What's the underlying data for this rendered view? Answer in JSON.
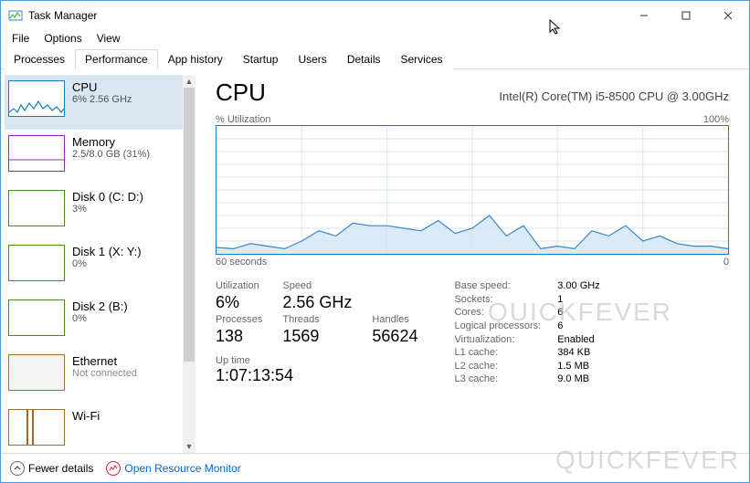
{
  "window": {
    "title": "Task Manager"
  },
  "menu": {
    "file": "File",
    "options": "Options",
    "view": "View"
  },
  "tabs": {
    "processes": "Processes",
    "performance": "Performance",
    "apphistory": "App history",
    "startup": "Startup",
    "users": "Users",
    "details": "Details",
    "services": "Services"
  },
  "sidebar": {
    "cpu": {
      "name": "CPU",
      "sub": "6%  2.56 GHz"
    },
    "mem": {
      "name": "Memory",
      "sub": "2.5/8.0 GB (31%)"
    },
    "disk0": {
      "name": "Disk 0 (C: D:)",
      "sub": "3%"
    },
    "disk1": {
      "name": "Disk 1 (X: Y:)",
      "sub": "0%"
    },
    "disk2": {
      "name": "Disk 2 (B:)",
      "sub": "0%"
    },
    "eth": {
      "name": "Ethernet",
      "sub": "Not connected"
    },
    "wifi": {
      "name": "Wi-Fi",
      "sub": ""
    }
  },
  "header": {
    "title": "CPU",
    "model": "Intel(R) Core(TM) i5-8500 CPU @ 3.00GHz"
  },
  "chart_labels": {
    "left": "% Utilization",
    "right": "100%",
    "xleft": "60 seconds",
    "xright": "0"
  },
  "chart_data": {
    "type": "area",
    "title": "% Utilization",
    "xlabel": "60 seconds → 0",
    "ylabel": "% Utilization",
    "ylim": [
      0,
      100
    ],
    "x_seconds_ago": [
      60,
      58,
      56,
      54,
      52,
      50,
      48,
      46,
      44,
      42,
      40,
      38,
      36,
      34,
      32,
      30,
      28,
      26,
      24,
      22,
      20,
      18,
      16,
      14,
      12,
      10,
      8,
      6,
      4,
      2,
      0
    ],
    "values": [
      5,
      4,
      8,
      6,
      4,
      10,
      18,
      14,
      24,
      22,
      22,
      20,
      18,
      26,
      16,
      20,
      30,
      14,
      22,
      4,
      6,
      4,
      18,
      14,
      22,
      10,
      14,
      8,
      6,
      6,
      4
    ]
  },
  "stats": {
    "utilization": {
      "label": "Utilization",
      "value": "6%"
    },
    "speed": {
      "label": "Speed",
      "value": "2.56 GHz"
    },
    "processes": {
      "label": "Processes",
      "value": "138"
    },
    "threads": {
      "label": "Threads",
      "value": "1569"
    },
    "handles": {
      "label": "Handles",
      "value": "56624"
    },
    "uptime": {
      "label": "Up time",
      "value": "1:07:13:54"
    }
  },
  "specs": {
    "base_speed": {
      "k": "Base speed:",
      "v": "3.00 GHz"
    },
    "sockets": {
      "k": "Sockets:",
      "v": "1"
    },
    "cores": {
      "k": "Cores:",
      "v": "6"
    },
    "logical": {
      "k": "Logical processors:",
      "v": "6"
    },
    "virt": {
      "k": "Virtualization:",
      "v": "Enabled"
    },
    "l1": {
      "k": "L1 cache:",
      "v": "384 KB"
    },
    "l2": {
      "k": "L2 cache:",
      "v": "1.5 MB"
    },
    "l3": {
      "k": "L3 cache:",
      "v": "9.0 MB"
    }
  },
  "footer": {
    "fewer": "Fewer details",
    "orm": "Open Resource Monitor"
  },
  "watermark": "QUICKFEVER"
}
